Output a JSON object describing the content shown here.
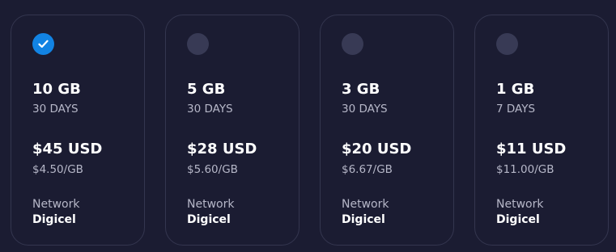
{
  "plans": [
    {
      "data": "10 GB",
      "validity": "30 DAYS",
      "price": "$45 USD",
      "unit_price": "$4.50/GB",
      "network_label": "Network",
      "network": "Digicel",
      "selected": true
    },
    {
      "data": "5 GB",
      "validity": "30 DAYS",
      "price": "$28 USD",
      "unit_price": "$5.60/GB",
      "network_label": "Network",
      "network": "Digicel",
      "selected": false
    },
    {
      "data": "3 GB",
      "validity": "30 DAYS",
      "price": "$20 USD",
      "unit_price": "$6.67/GB",
      "network_label": "Network",
      "network": "Digicel",
      "selected": false
    },
    {
      "data": "1 GB",
      "validity": "7 DAYS",
      "price": "$11 USD",
      "unit_price": "$11.00/GB",
      "network_label": "Network",
      "network": "Digicel",
      "selected": false
    }
  ],
  "colors": {
    "background": "#1b1c32",
    "card_border": "#34364f",
    "radio_unselected": "#383a55",
    "radio_selected": "#1283e3",
    "secondary_text": "#b6b7c8",
    "primary_text": "#ffffff"
  },
  "icons": {
    "selected_radio": "check-icon"
  }
}
